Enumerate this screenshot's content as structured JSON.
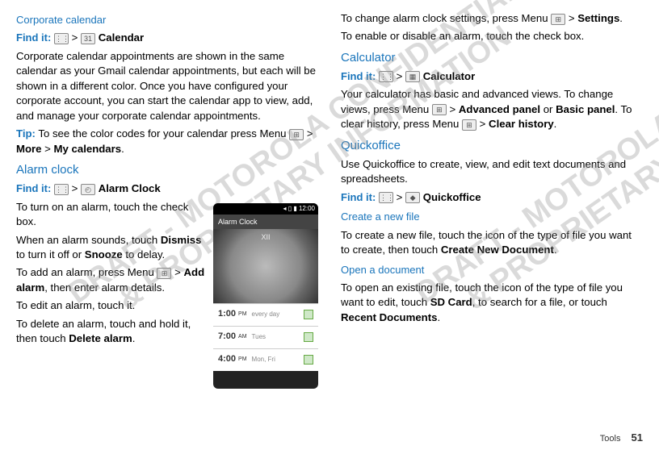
{
  "left": {
    "corpCal": {
      "title": "Corporate calendar",
      "find_label": "Find it:",
      "apps_icon": "⋮⋮",
      "gt1": ">",
      "cal_icon": "31",
      "cal_label": "Calendar",
      "body": "Corporate calendar appointments are shown in the same calendar as your Gmail calendar appointments, but each will be shown in a different color. Once you have configured your corporate account, you can start the calendar app to view, add, and manage your corporate calendar appointments.",
      "tip_label": "Tip:",
      "tip_pre": " To see the color codes for your calendar press Menu ",
      "menu_icon": "⊞",
      "tip_gt": " > ",
      "tip_b1": "More",
      "tip_gt2": " > ",
      "tip_b2": "My calendars",
      "tip_end": "."
    },
    "alarm": {
      "title": "Alarm clock",
      "find_label": "Find it:",
      "apps_icon": "⋮⋮",
      "gt1": ">",
      "clock_icon": "◴",
      "clock_label": "Alarm Clock",
      "p1": "To turn on an alarm, touch the check box.",
      "p2a": "When an alarm sounds, touch ",
      "p2_dismiss": "Dismiss",
      "p2b": " to turn it off or ",
      "p2_snooze": "Snooze",
      "p2c": " to delay.",
      "p3a": "To add an alarm, press Menu ",
      "p3_gt": " > ",
      "p3_add": "Add alarm",
      "p3b": ", then enter alarm details.",
      "p4": "To edit an alarm, touch it.",
      "p5a": "To delete an alarm, touch and hold it, then touch ",
      "p5_del": "Delete alarm",
      "p5b": "."
    },
    "phone": {
      "status": "◂ ▯ ▮ 12:00",
      "title": "Alarm Clock",
      "nums": "XII",
      "r1_t": "1:00",
      "r1_ap": "PM",
      "r1_d": "every day",
      "r2_t": "7:00",
      "r2_ap": "AM",
      "r2_d": "Tues",
      "r3_t": "4:00",
      "r3_ap": "PM",
      "r3_d": "Mon, Fri"
    }
  },
  "right": {
    "alarm_cont": {
      "p1a": "To change alarm clock settings, press Menu ",
      "p1_gt": " > ",
      "p1_set": "Settings",
      "p1b": ".",
      "p2": "To enable or disable an alarm, touch the check box."
    },
    "calc": {
      "title": "Calculator",
      "find_label": "Find it:",
      "apps_icon": "⋮⋮",
      "gt1": ">",
      "calc_icon": "▦",
      "calc_label": "Calculator",
      "p1a": "Your calculator has basic and advanced views. To change views, press Menu ",
      "p1_gt": " > ",
      "p1_adv": "Advanced panel",
      "p1_or": " or ",
      "p1_basic": "Basic panel",
      "p1b": ". To clear history, press Menu ",
      "p1_gt2": " > ",
      "p1_clear": "Clear history",
      "p1c": "."
    },
    "qo": {
      "title": "Quickoffice",
      "p1": "Use Quickoffice to create, view, and edit text documents and spreadsheets.",
      "find_label": "Find it:",
      "apps_icon": "⋮⋮",
      "gt1": ">",
      "qo_icon": "◆",
      "qo_label": "Quickoffice",
      "sub1": "Create a new file",
      "s1a": "To create a new file, touch the icon of the type of file you want to create, then touch ",
      "s1_cn": "Create New Document",
      "s1b": ".",
      "sub2": "Open a document",
      "s2a": "To open an existing file, touch the icon of the type of file you want to edit, touch ",
      "s2_sd": "SD Card",
      "s2b": ", to search for a file, or touch ",
      "s2_rd": "Recent Documents",
      "s2c": "."
    }
  },
  "footer": {
    "section": "Tools",
    "page": "51"
  },
  "watermark": "DRAFT - MOTOROLA CONFIDENTIAL\n& PROPRIETARY INFORMATION"
}
